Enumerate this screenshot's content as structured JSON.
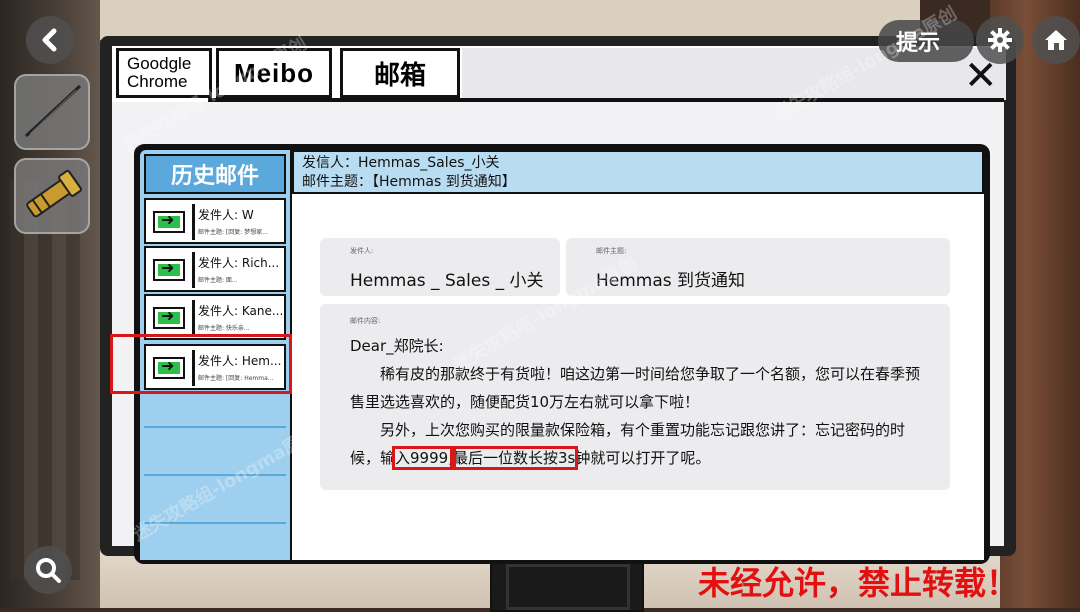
{
  "hud": {
    "hint_label": "提示",
    "watermark_text": "迷失攻略组-longma原创",
    "copyright_text": "未经允许，禁止转载！"
  },
  "browser": {
    "tabs": [
      {
        "line1": "Goodgle",
        "line2": "Chrome"
      },
      {
        "label": "Meibo"
      },
      {
        "label": "邮箱"
      }
    ]
  },
  "mail": {
    "inbox_title": "历史邮件",
    "items": [
      {
        "sender": "发件人: W",
        "subject": "邮件主题: [回复: 梦想家..."
      },
      {
        "sender": "发件人: Rich...",
        "subject": "邮件主题: 面..."
      },
      {
        "sender": "发件人: Kane...",
        "subject": "邮件主题: 快乐亲..."
      },
      {
        "sender": "发件人: Hem...",
        "subject": "邮件主题: [回复: Hemma..."
      }
    ],
    "header": {
      "from_line": "发信人：Hemmas_Sales_小关",
      "subject_line": "邮件主题：【Hemmas 到货通知】"
    },
    "detail": {
      "from_label": "发件人:",
      "from_value": "Hemmas _ Sales _ 小关",
      "subject_label": "邮件主题:",
      "subject_value": "Hemmas 到货通知",
      "content_label": "邮件内容:",
      "greeting": "Dear_郑院长:",
      "para1": "稀有皮的那款终于有货啦！咱这边第一时间给您争取了一个名额，您可以在春季预售里选选喜欢的，随便配货10万左右就可以拿下啦！",
      "para2_a": "另外，上次您购买的限量款保险箱，有个重置功能忘记跟您讲了：忘记密码的时候，输",
      "para2_hl1": "入9999,",
      "para2_hl2": "最后一位数长按3s",
      "para2_c": "钟就可以打开了呢。"
    }
  },
  "colors": {
    "accent_blue": "#5aa8dc",
    "panel_blue": "#9ecfee",
    "highlight_red": "#d81818"
  }
}
